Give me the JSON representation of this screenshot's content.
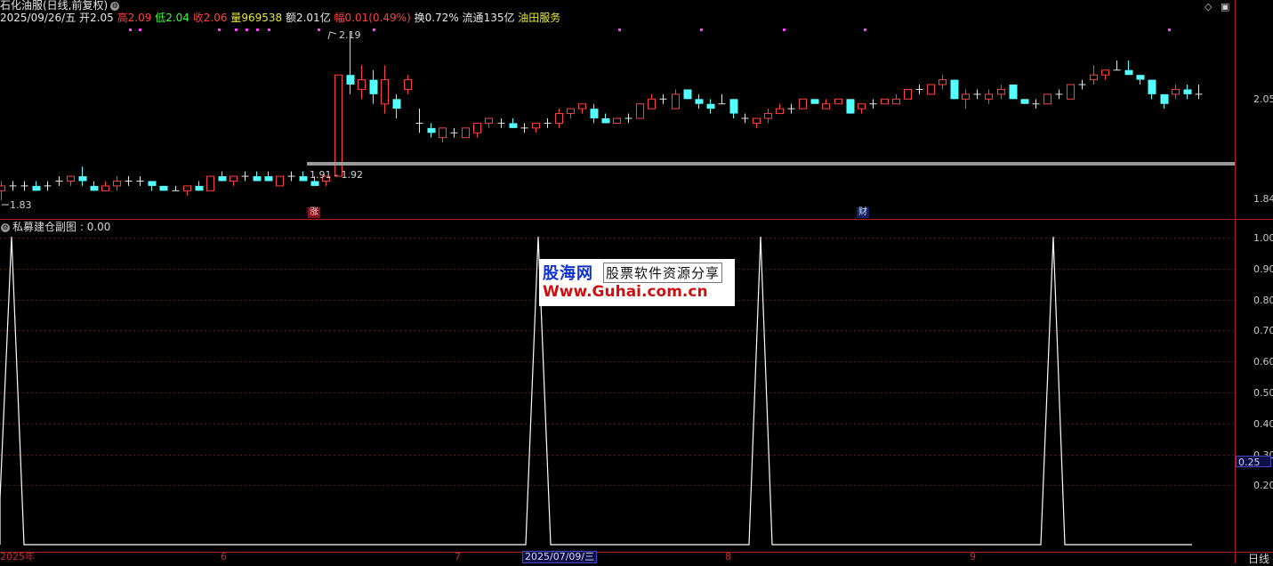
{
  "header": {
    "stock_name": "石化油服(日线,前复权)",
    "date": "2025/09/26/五",
    "open_label": "开",
    "open": "2.05",
    "high_label": "高",
    "high": "2.09",
    "low_label": "低",
    "low": "2.04",
    "close_label": "收",
    "close": "2.06",
    "volume_label": "量",
    "volume": "969538",
    "amount_label": "额",
    "amount": "2.01亿",
    "change_label": "幅",
    "change": "0.01(0.49%)",
    "turnover_label": "换",
    "turnover": "0.72%",
    "float_label": "流通",
    "float_cap": "135亿",
    "sector": "油田服务"
  },
  "main_chart": {
    "price_axis_labels": [
      "2.05",
      "1.84"
    ],
    "max_price_label": "2.19",
    "min_price_label": "1.83",
    "range_label": "1.91 - 1.92",
    "markers": [
      "涨",
      "财"
    ],
    "colors": {
      "up": "#ff4040",
      "down": "#54ffff",
      "doji": "#e8e8e8",
      "support": "#9a9a9a",
      "dot": "#ff40ff"
    }
  },
  "sub_chart": {
    "title": "私募建仓副图",
    "value": "0.00",
    "axis_labels": [
      "1.00",
      "0.90",
      "0.80",
      "0.70",
      "0.60",
      "0.50",
      "0.40",
      "0.30",
      "0.20"
    ],
    "cursor_value": "0.25",
    "line_color": "#ffffff"
  },
  "time_axis": {
    "labels": [
      "2025年",
      "6",
      "7",
      "2025/07/09/三",
      "8",
      "9"
    ],
    "period": "日线"
  },
  "watermark": {
    "brand": "股海网",
    "slogan": "股票软件资源分享",
    "url": "Www.Guhai.com.cn"
  },
  "chart_data": {
    "type": "candlestick",
    "candles": [
      {
        "o": 1.86,
        "h": 1.88,
        "l": 1.84,
        "c": 1.87
      },
      {
        "o": 1.87,
        "h": 1.88,
        "l": 1.86,
        "c": 1.87
      },
      {
        "o": 1.87,
        "h": 1.88,
        "l": 1.86,
        "c": 1.87
      },
      {
        "o": 1.87,
        "h": 1.88,
        "l": 1.86,
        "c": 1.86
      },
      {
        "o": 1.87,
        "h": 1.88,
        "l": 1.86,
        "c": 1.87
      },
      {
        "o": 1.88,
        "h": 1.89,
        "l": 1.87,
        "c": 1.88
      },
      {
        "o": 1.88,
        "h": 1.89,
        "l": 1.87,
        "c": 1.89
      },
      {
        "o": 1.89,
        "h": 1.91,
        "l": 1.87,
        "c": 1.88
      },
      {
        "o": 1.87,
        "h": 1.88,
        "l": 1.86,
        "c": 1.86
      },
      {
        "o": 1.86,
        "h": 1.88,
        "l": 1.86,
        "c": 1.87
      },
      {
        "o": 1.87,
        "h": 1.89,
        "l": 1.86,
        "c": 1.88
      },
      {
        "o": 1.88,
        "h": 1.89,
        "l": 1.87,
        "c": 1.88
      },
      {
        "o": 1.88,
        "h": 1.89,
        "l": 1.87,
        "c": 1.88
      },
      {
        "o": 1.88,
        "h": 1.88,
        "l": 1.86,
        "c": 1.87
      },
      {
        "o": 1.87,
        "h": 1.87,
        "l": 1.86,
        "c": 1.86
      },
      {
        "o": 1.86,
        "h": 1.87,
        "l": 1.86,
        "c": 1.86
      },
      {
        "o": 1.86,
        "h": 1.87,
        "l": 1.85,
        "c": 1.87
      },
      {
        "o": 1.87,
        "h": 1.88,
        "l": 1.86,
        "c": 1.86
      },
      {
        "o": 1.86,
        "h": 1.89,
        "l": 1.86,
        "c": 1.89
      },
      {
        "o": 1.89,
        "h": 1.9,
        "l": 1.88,
        "c": 1.88
      },
      {
        "o": 1.88,
        "h": 1.89,
        "l": 1.87,
        "c": 1.89
      },
      {
        "o": 1.89,
        "h": 1.9,
        "l": 1.88,
        "c": 1.89
      },
      {
        "o": 1.89,
        "h": 1.9,
        "l": 1.88,
        "c": 1.88
      },
      {
        "o": 1.89,
        "h": 1.9,
        "l": 1.88,
        "c": 1.88
      },
      {
        "o": 1.87,
        "h": 1.89,
        "l": 1.87,
        "c": 1.89
      },
      {
        "o": 1.89,
        "h": 1.9,
        "l": 1.88,
        "c": 1.89
      },
      {
        "o": 1.89,
        "h": 1.9,
        "l": 1.88,
        "c": 1.88
      },
      {
        "o": 1.88,
        "h": 1.89,
        "l": 1.87,
        "c": 1.87
      },
      {
        "o": 1.88,
        "h": 1.89,
        "l": 1.87,
        "c": 1.89
      },
      {
        "o": 1.89,
        "h": 2.1,
        "l": 1.89,
        "c": 2.1
      },
      {
        "o": 2.1,
        "h": 2.19,
        "l": 2.06,
        "c": 2.08
      },
      {
        "o": 2.07,
        "h": 2.12,
        "l": 2.05,
        "c": 2.09
      },
      {
        "o": 2.09,
        "h": 2.11,
        "l": 2.04,
        "c": 2.06
      },
      {
        "o": 2.04,
        "h": 2.12,
        "l": 2.02,
        "c": 2.09
      },
      {
        "o": 2.05,
        "h": 2.06,
        "l": 2.01,
        "c": 2.03
      },
      {
        "o": 2.07,
        "h": 2.1,
        "l": 2.06,
        "c": 2.09
      },
      {
        "o": 2.0,
        "h": 2.03,
        "l": 1.98,
        "c": 2.0
      },
      {
        "o": 1.99,
        "h": 2.0,
        "l": 1.97,
        "c": 1.98
      },
      {
        "o": 1.97,
        "h": 1.99,
        "l": 1.96,
        "c": 1.99
      },
      {
        "o": 1.98,
        "h": 1.99,
        "l": 1.97,
        "c": 1.98
      },
      {
        "o": 1.97,
        "h": 1.99,
        "l": 1.97,
        "c": 1.99
      },
      {
        "o": 1.98,
        "h": 2.0,
        "l": 1.97,
        "c": 2.0
      },
      {
        "o": 2.0,
        "h": 2.01,
        "l": 1.99,
        "c": 2.01
      },
      {
        "o": 2.0,
        "h": 2.01,
        "l": 1.99,
        "c": 2.0
      },
      {
        "o": 2.0,
        "h": 2.01,
        "l": 1.99,
        "c": 1.99
      },
      {
        "o": 1.99,
        "h": 2.0,
        "l": 1.98,
        "c": 1.99
      },
      {
        "o": 1.99,
        "h": 2.0,
        "l": 1.98,
        "c": 2.0
      },
      {
        "o": 2.0,
        "h": 2.01,
        "l": 1.99,
        "c": 2.0
      },
      {
        "o": 2.0,
        "h": 2.03,
        "l": 1.99,
        "c": 2.02
      },
      {
        "o": 2.02,
        "h": 2.03,
        "l": 2.01,
        "c": 2.03
      },
      {
        "o": 2.03,
        "h": 2.04,
        "l": 2.02,
        "c": 2.04
      },
      {
        "o": 2.03,
        "h": 2.04,
        "l": 2.0,
        "c": 2.01
      },
      {
        "o": 2.01,
        "h": 2.02,
        "l": 2.0,
        "c": 2.0
      },
      {
        "o": 2.0,
        "h": 2.01,
        "l": 2.0,
        "c": 2.01
      },
      {
        "o": 2.01,
        "h": 2.02,
        "l": 2.0,
        "c": 2.01
      },
      {
        "o": 2.01,
        "h": 2.04,
        "l": 2.01,
        "c": 2.04
      },
      {
        "o": 2.03,
        "h": 2.06,
        "l": 2.03,
        "c": 2.05
      },
      {
        "o": 2.05,
        "h": 2.06,
        "l": 2.04,
        "c": 2.05
      },
      {
        "o": 2.03,
        "h": 2.07,
        "l": 2.03,
        "c": 2.06
      },
      {
        "o": 2.07,
        "h": 2.07,
        "l": 2.05,
        "c": 2.05
      },
      {
        "o": 2.05,
        "h": 2.06,
        "l": 2.03,
        "c": 2.04
      },
      {
        "o": 2.04,
        "h": 2.05,
        "l": 2.02,
        "c": 2.03
      },
      {
        "o": 2.04,
        "h": 2.06,
        "l": 2.04,
        "c": 2.04
      },
      {
        "o": 2.05,
        "h": 2.05,
        "l": 2.01,
        "c": 2.02
      },
      {
        "o": 2.01,
        "h": 2.02,
        "l": 2.0,
        "c": 2.01
      },
      {
        "o": 2.0,
        "h": 2.01,
        "l": 1.99,
        "c": 2.01
      },
      {
        "o": 2.01,
        "h": 2.03,
        "l": 2.0,
        "c": 2.02
      },
      {
        "o": 2.02,
        "h": 2.04,
        "l": 2.02,
        "c": 2.03
      },
      {
        "o": 2.03,
        "h": 2.04,
        "l": 2.02,
        "c": 2.03
      },
      {
        "o": 2.03,
        "h": 2.05,
        "l": 2.03,
        "c": 2.05
      },
      {
        "o": 2.05,
        "h": 2.05,
        "l": 2.04,
        "c": 2.04
      },
      {
        "o": 2.03,
        "h": 2.05,
        "l": 2.03,
        "c": 2.04
      },
      {
        "o": 2.04,
        "h": 2.05,
        "l": 2.04,
        "c": 2.05
      },
      {
        "o": 2.05,
        "h": 2.05,
        "l": 2.02,
        "c": 2.02
      },
      {
        "o": 2.03,
        "h": 2.04,
        "l": 2.02,
        "c": 2.04
      },
      {
        "o": 2.04,
        "h": 2.05,
        "l": 2.03,
        "c": 2.04
      },
      {
        "o": 2.04,
        "h": 2.05,
        "l": 2.04,
        "c": 2.05
      },
      {
        "o": 2.04,
        "h": 2.06,
        "l": 2.04,
        "c": 2.05
      },
      {
        "o": 2.05,
        "h": 2.07,
        "l": 2.05,
        "c": 2.07
      },
      {
        "o": 2.07,
        "h": 2.08,
        "l": 2.06,
        "c": 2.07
      },
      {
        "o": 2.06,
        "h": 2.08,
        "l": 2.06,
        "c": 2.08
      },
      {
        "o": 2.08,
        "h": 2.1,
        "l": 2.07,
        "c": 2.09
      },
      {
        "o": 2.09,
        "h": 2.09,
        "l": 2.05,
        "c": 2.05
      },
      {
        "o": 2.05,
        "h": 2.07,
        "l": 2.03,
        "c": 2.06
      },
      {
        "o": 2.06,
        "h": 2.07,
        "l": 2.05,
        "c": 2.06
      },
      {
        "o": 2.05,
        "h": 2.07,
        "l": 2.04,
        "c": 2.06
      },
      {
        "o": 2.06,
        "h": 2.08,
        "l": 2.05,
        "c": 2.07
      },
      {
        "o": 2.08,
        "h": 2.08,
        "l": 2.05,
        "c": 2.05
      },
      {
        "o": 2.05,
        "h": 2.05,
        "l": 2.04,
        "c": 2.04
      },
      {
        "o": 2.04,
        "h": 2.05,
        "l": 2.03,
        "c": 2.04
      },
      {
        "o": 2.04,
        "h": 2.06,
        "l": 2.04,
        "c": 2.06
      },
      {
        "o": 2.06,
        "h": 2.07,
        "l": 2.05,
        "c": 2.06
      },
      {
        "o": 2.05,
        "h": 2.08,
        "l": 2.05,
        "c": 2.08
      },
      {
        "o": 2.08,
        "h": 2.09,
        "l": 2.07,
        "c": 2.08
      },
      {
        "o": 2.09,
        "h": 2.12,
        "l": 2.08,
        "c": 2.1
      },
      {
        "o": 2.1,
        "h": 2.11,
        "l": 2.09,
        "c": 2.11
      },
      {
        "o": 2.11,
        "h": 2.13,
        "l": 2.11,
        "c": 2.11
      },
      {
        "o": 2.11,
        "h": 2.13,
        "l": 2.1,
        "c": 2.1
      },
      {
        "o": 2.1,
        "h": 2.1,
        "l": 2.08,
        "c": 2.09
      },
      {
        "o": 2.09,
        "h": 2.09,
        "l": 2.05,
        "c": 2.06
      },
      {
        "o": 2.06,
        "h": 2.06,
        "l": 2.03,
        "c": 2.04
      },
      {
        "o": 2.06,
        "h": 2.08,
        "l": 2.05,
        "c": 2.07
      },
      {
        "o": 2.07,
        "h": 2.08,
        "l": 2.05,
        "c": 2.06
      },
      {
        "o": 2.06,
        "h": 2.08,
        "l": 2.05,
        "c": 2.06
      }
    ],
    "signal": [
      1.0,
      0,
      0,
      0,
      0,
      0,
      0,
      0,
      0,
      0,
      0,
      0,
      0,
      0,
      0,
      0,
      0,
      0,
      0,
      0,
      0,
      0,
      0,
      0,
      0,
      0,
      0,
      0,
      0,
      0,
      0,
      0,
      0,
      0,
      0,
      0,
      0,
      0,
      0,
      0,
      0,
      0,
      0,
      0,
      1.0,
      0,
      0,
      0,
      0,
      0,
      0,
      0,
      0,
      0,
      0,
      0,
      0,
      0,
      0,
      0,
      0,
      0,
      0,
      1.0,
      0,
      0,
      0,
      0,
      0,
      0,
      0,
      0,
      0,
      0,
      0,
      0,
      0,
      0,
      0,
      0,
      0,
      0,
      0,
      0,
      0,
      0,
      0,
      0,
      1.0,
      0,
      0,
      0,
      0,
      0,
      0,
      0,
      0,
      0,
      0,
      0,
      0
    ],
    "ylim_main": [
      1.82,
      2.2
    ],
    "ylim_sub": [
      0,
      1.0
    ]
  }
}
